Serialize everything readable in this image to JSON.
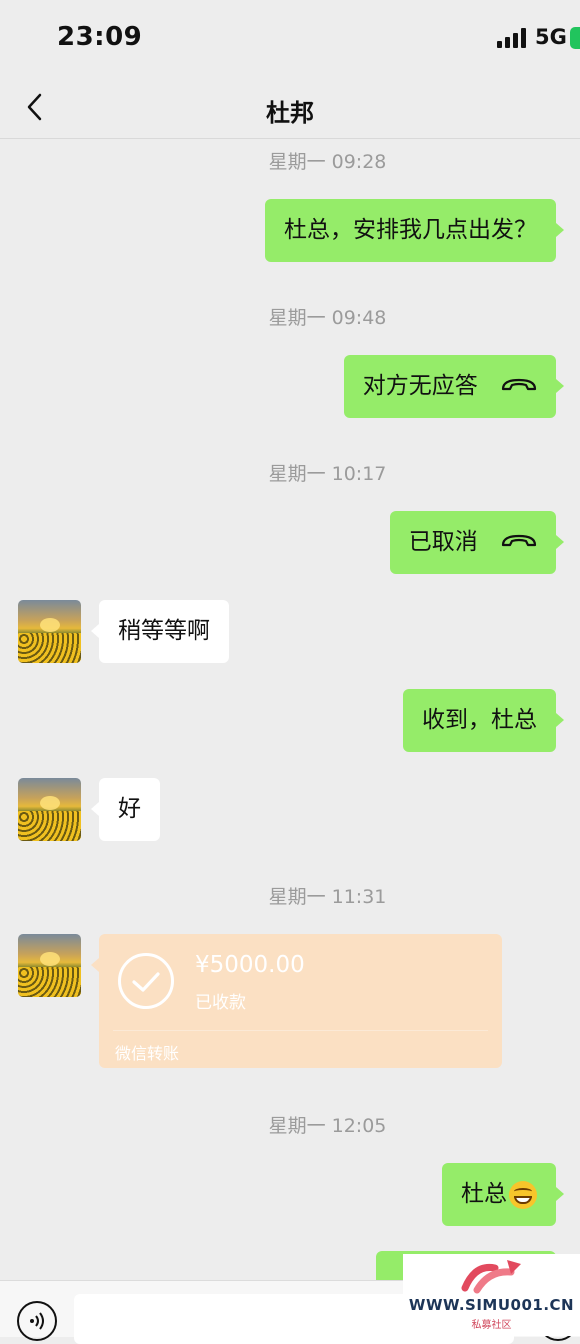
{
  "status_bar": {
    "time": "23:09",
    "network": "5G"
  },
  "header": {
    "title": "杜邦"
  },
  "messages": {
    "ts1": "星期一 09:28",
    "m1": "杜总，安排我几点出发？",
    "ts2": "星期一 09:48",
    "m2": "对方无应答",
    "ts3": "星期一 10:17",
    "m3": "已取消",
    "m4": "稍等等啊",
    "m5": "收到，杜总",
    "m6": "好",
    "ts4": "星期一 11:31",
    "transfer": {
      "amount": "¥5000.00",
      "status": "已收款",
      "label": "微信转账"
    },
    "ts5": "星期一 12:05",
    "m7": "杜总"
  },
  "icons": {
    "back": "chevron-left-icon",
    "call": "phone-hangup-icon",
    "transfer": "check-circle-icon",
    "emoji": "grinning-face-emoji",
    "voice": "voice-icon"
  },
  "watermark": {
    "url": "WWW.SIMU001.CN",
    "sub": "私募社区"
  },
  "colors": {
    "self_bubble": "#95ec69",
    "other_bubble": "#ffffff",
    "transfer_bg": "#fbe0c3",
    "background": "#ededed"
  }
}
